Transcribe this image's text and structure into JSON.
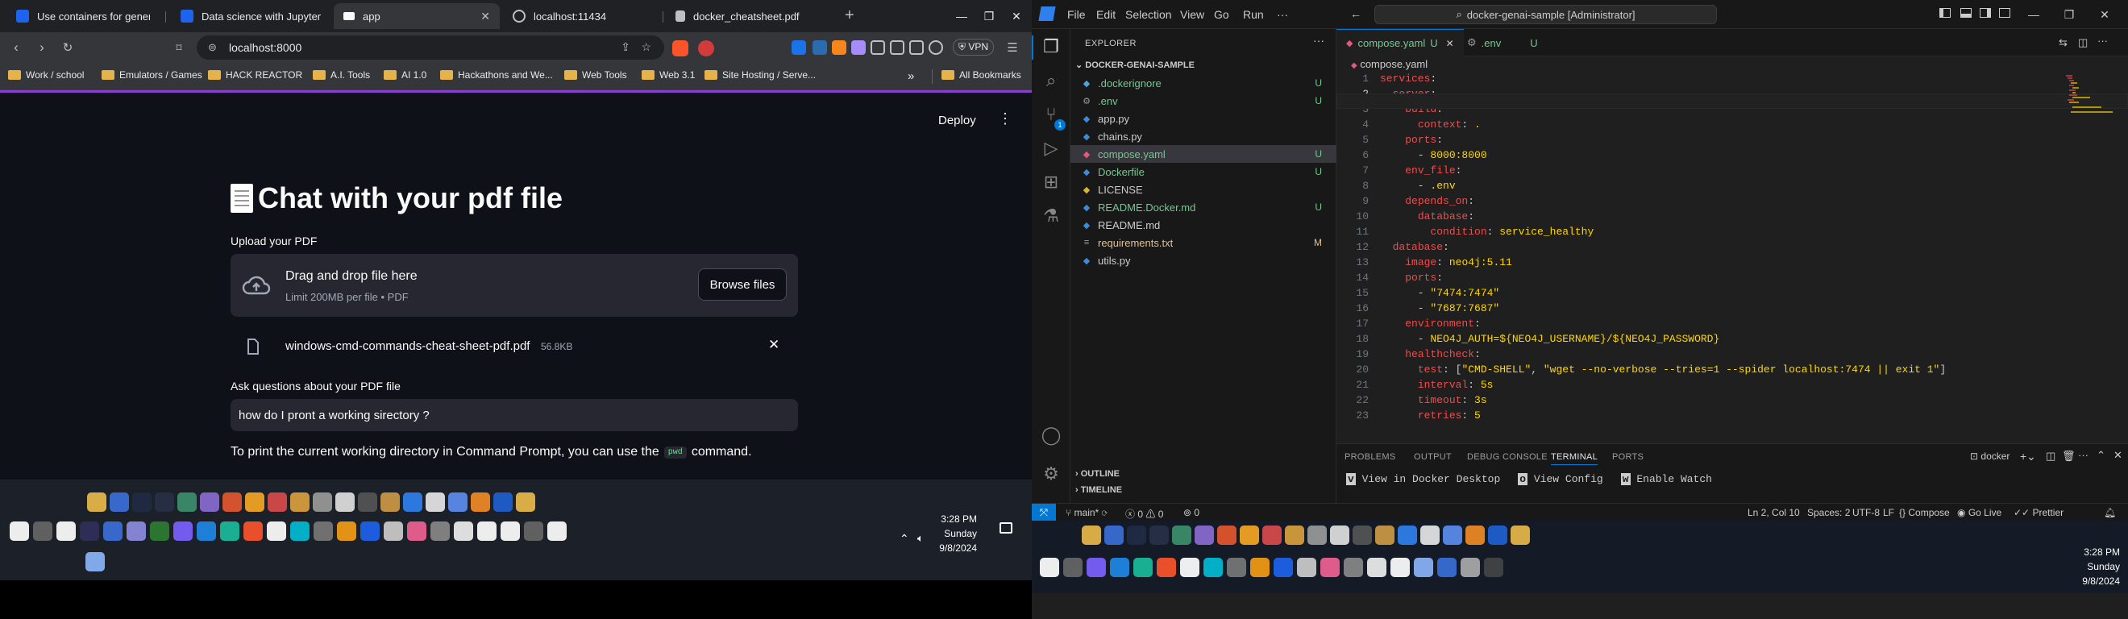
{
  "browser": {
    "tabs": [
      {
        "title": "Use containers for generative",
        "color": "#4a90e2"
      },
      {
        "title": "Data science with JupyterLab",
        "color": "#e8eaed"
      },
      {
        "title": "app",
        "color": "#e8eaed"
      },
      {
        "title": "localhost:11434",
        "color": "#e8eaed"
      },
      {
        "title": "docker_cheatsheet.pdf",
        "color": "#e8eaed"
      }
    ],
    "new_tab": "+",
    "url": "localhost:8000",
    "vpn": "VPN",
    "bookmarks": [
      "Work / school",
      "Emulators / Games",
      "HACK REACTOR",
      "A.I. Tools",
      "AI 1.0",
      "Hackathons and We...",
      "Web Tools",
      "Web 3.1",
      "Site Hosting / Serve..."
    ],
    "overflow": "»",
    "all_bookmarks": "All Bookmarks"
  },
  "app": {
    "deploy": "Deploy",
    "title": "Chat with your pdf file",
    "upload_label": "Upload your PDF",
    "drop_title": "Drag and drop file here",
    "drop_limit": "Limit 200MB per file • PDF",
    "browse": "Browse files",
    "file_name": "windows-cmd-commands-cheat-sheet-pdf.pdf",
    "file_size": "56.8KB",
    "question_label": "Ask questions about your PDF file",
    "question_value": "how do I pront a working sirectory ?",
    "answer_pre": "To print the current working directory in Command Prompt, you can use the",
    "answer_code": "pwd",
    "answer_post": "command."
  },
  "left_tray": {
    "time": "3:28 PM",
    "day": "Sunday",
    "date": "9/8/2024"
  },
  "vscode": {
    "menus": [
      "File",
      "Edit",
      "Selection",
      "View",
      "Go",
      "Run",
      "···"
    ],
    "command_center": "docker-genai-sample [Administrator]",
    "explorer": "EXPLORER",
    "project": "DOCKER-GENAI-SAMPLE",
    "files": [
      {
        "name": ".dockerignore",
        "status": "U",
        "color": "#73c991",
        "icon": "◆",
        "icolor": "#4fa3d8"
      },
      {
        "name": ".env",
        "status": "U",
        "color": "#73c991",
        "icon": "⚙",
        "icolor": "#999"
      },
      {
        "name": "app.py",
        "status": "",
        "color": "#cccccc",
        "icon": "◆",
        "icolor": "#3d8bd6"
      },
      {
        "name": "chains.py",
        "status": "",
        "color": "#cccccc",
        "icon": "◆",
        "icolor": "#3d8bd6"
      },
      {
        "name": "compose.yaml",
        "status": "U",
        "color": "#73c991",
        "icon": "◆",
        "icolor": "#e05a7a"
      },
      {
        "name": "Dockerfile",
        "status": "U",
        "color": "#73c991",
        "icon": "◆",
        "icolor": "#3d8bd6"
      },
      {
        "name": "LICENSE",
        "status": "",
        "color": "#cccccc",
        "icon": "◆",
        "icolor": "#d9b335"
      },
      {
        "name": "README.Docker.md",
        "status": "U",
        "color": "#73c991",
        "icon": "◆",
        "icolor": "#3d8bd6"
      },
      {
        "name": "README.md",
        "status": "",
        "color": "#cccccc",
        "icon": "◆",
        "icolor": "#3d8bd6"
      },
      {
        "name": "requirements.txt",
        "status": "M",
        "color": "#e2c08d",
        "icon": "≡",
        "icolor": "#999"
      },
      {
        "name": "utils.py",
        "status": "",
        "color": "#cccccc",
        "icon": "◆",
        "icolor": "#3d8bd6"
      }
    ],
    "outline": "OUTLINE",
    "timeline": "TIMELINE",
    "editor_tabs": [
      {
        "name": "compose.yaml",
        "flag": "U"
      },
      {
        "name": ".env",
        "flag": "U"
      }
    ],
    "breadcrumb": "compose.yaml",
    "code": [
      [
        {
          "t": "services",
          "c": "k"
        },
        {
          "t": ":",
          "c": ""
        }
      ],
      [
        {
          "t": "  ",
          "c": ""
        },
        {
          "t": "server",
          "c": "k"
        },
        {
          "t": ":",
          "c": ""
        }
      ],
      [
        {
          "t": "    ",
          "c": ""
        },
        {
          "t": "build",
          "c": "k"
        },
        {
          "t": ":",
          "c": ""
        }
      ],
      [
        {
          "t": "      ",
          "c": ""
        },
        {
          "t": "context",
          "c": "k"
        },
        {
          "t": ": ",
          "c": ""
        },
        {
          "t": ".",
          "c": "v"
        }
      ],
      [
        {
          "t": "    ",
          "c": ""
        },
        {
          "t": "ports",
          "c": "k"
        },
        {
          "t": ":",
          "c": ""
        }
      ],
      [
        {
          "t": "      - ",
          "c": ""
        },
        {
          "t": "8000:8000",
          "c": "v"
        }
      ],
      [
        {
          "t": "    ",
          "c": ""
        },
        {
          "t": "env_file",
          "c": "k"
        },
        {
          "t": ":",
          "c": ""
        }
      ],
      [
        {
          "t": "      - ",
          "c": ""
        },
        {
          "t": ".env",
          "c": "v"
        }
      ],
      [
        {
          "t": "    ",
          "c": ""
        },
        {
          "t": "depends_on",
          "c": "k"
        },
        {
          "t": ":",
          "c": ""
        }
      ],
      [
        {
          "t": "      ",
          "c": ""
        },
        {
          "t": "database",
          "c": "k"
        },
        {
          "t": ":",
          "c": ""
        }
      ],
      [
        {
          "t": "        ",
          "c": ""
        },
        {
          "t": "condition",
          "c": "k"
        },
        {
          "t": ": ",
          "c": ""
        },
        {
          "t": "service_healthy",
          "c": "v"
        }
      ],
      [
        {
          "t": "  ",
          "c": ""
        },
        {
          "t": "database",
          "c": "k"
        },
        {
          "t": ":",
          "c": ""
        }
      ],
      [
        {
          "t": "    ",
          "c": ""
        },
        {
          "t": "image",
          "c": "k"
        },
        {
          "t": ": ",
          "c": ""
        },
        {
          "t": "neo4j:5.11",
          "c": "v"
        }
      ],
      [
        {
          "t": "    ",
          "c": ""
        },
        {
          "t": "ports",
          "c": "k"
        },
        {
          "t": ":",
          "c": ""
        }
      ],
      [
        {
          "t": "      - ",
          "c": ""
        },
        {
          "t": "\"7474:7474\"",
          "c": "v"
        }
      ],
      [
        {
          "t": "      - ",
          "c": ""
        },
        {
          "t": "\"7687:7687\"",
          "c": "v"
        }
      ],
      [
        {
          "t": "    ",
          "c": ""
        },
        {
          "t": "environment",
          "c": "k"
        },
        {
          "t": ":",
          "c": ""
        }
      ],
      [
        {
          "t": "      - ",
          "c": ""
        },
        {
          "t": "NEO4J_AUTH=${NEO4J_USERNAME}/${NEO4J_PASSWORD}",
          "c": "v"
        }
      ],
      [
        {
          "t": "    ",
          "c": ""
        },
        {
          "t": "healthcheck",
          "c": "k"
        },
        {
          "t": ":",
          "c": ""
        }
      ],
      [
        {
          "t": "      ",
          "c": ""
        },
        {
          "t": "test",
          "c": "k"
        },
        {
          "t": ": [",
          "c": ""
        },
        {
          "t": "\"CMD-SHELL\"",
          "c": "v"
        },
        {
          "t": ", ",
          "c": ""
        },
        {
          "t": "\"wget --no-verbose --tries=1 --spider localhost:7474 || exit 1\"",
          "c": "v"
        },
        {
          "t": "]",
          "c": ""
        }
      ],
      [
        {
          "t": "      ",
          "c": ""
        },
        {
          "t": "interval",
          "c": "k"
        },
        {
          "t": ": ",
          "c": ""
        },
        {
          "t": "5s",
          "c": "v"
        }
      ],
      [
        {
          "t": "      ",
          "c": ""
        },
        {
          "t": "timeout",
          "c": "k"
        },
        {
          "t": ": ",
          "c": ""
        },
        {
          "t": "3s",
          "c": "v"
        }
      ],
      [
        {
          "t": "      ",
          "c": ""
        },
        {
          "t": "retries",
          "c": "k"
        },
        {
          "t": ": ",
          "c": ""
        },
        {
          "t": "5",
          "c": "v"
        }
      ]
    ],
    "panel_tabs": [
      "PROBLEMS",
      "OUTPUT",
      "DEBUG CONSOLE",
      "TERMINAL",
      "PORTS"
    ],
    "terminal_name": "docker",
    "docker_actions": [
      "View in Docker Desktop",
      "View Config",
      "Enable Watch"
    ],
    "status": {
      "branch": "main*",
      "errors": "0",
      "warnings": "0",
      "ports": "0",
      "position": "Ln 2, Col 10",
      "spaces": "Spaces: 2",
      "encoding": "UTF-8",
      "eol": "LF",
      "language": "Compose",
      "golive": "Go Live",
      "prettier": "Prettier"
    },
    "tray": {
      "time": "3:28 PM",
      "day": "Sunday",
      "date": "9/8/2024"
    }
  }
}
